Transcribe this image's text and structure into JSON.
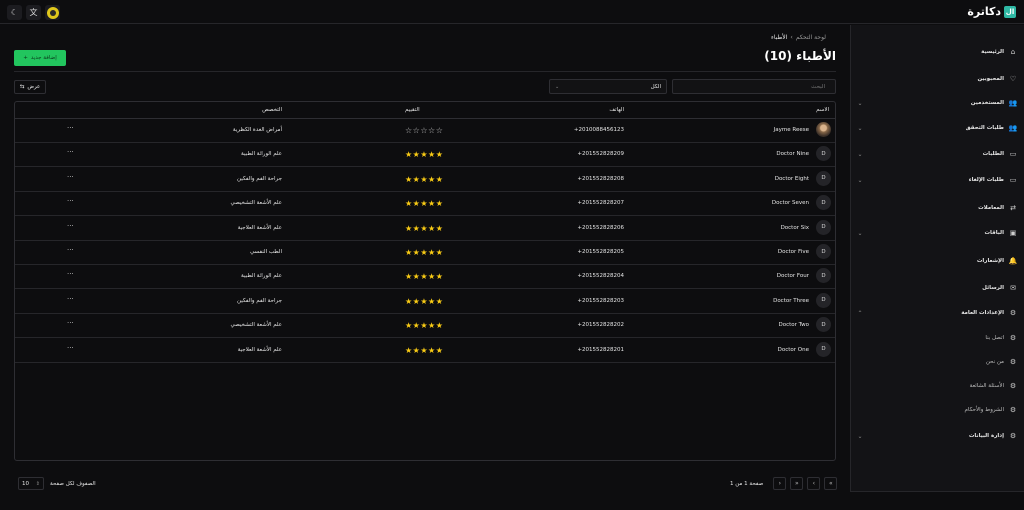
{
  "app": {
    "name": "دكاترة",
    "logo_mark": "ال"
  },
  "topbar": {
    "theme_icon": "moon-icon",
    "translate_icon": "translate-icon"
  },
  "sidebar": {
    "items": [
      {
        "label": "الرئيسية",
        "icon": "⌂",
        "chevron": ""
      },
      {
        "label": "المحبوبين",
        "icon": "♡",
        "chevron": ""
      },
      {
        "label": "المستخدمين",
        "icon": "👥",
        "chevron": "⌄"
      },
      {
        "label": "طلبات التحقق",
        "icon": "👥",
        "chevron": "⌄"
      },
      {
        "label": "الطلبات",
        "icon": "▭",
        "chevron": "⌄"
      },
      {
        "label": "طلبات الإلغاء",
        "icon": "▭",
        "chevron": "⌄"
      },
      {
        "label": "المعاملات",
        "icon": "⇄",
        "chevron": ""
      },
      {
        "label": "الباقات",
        "icon": "▣",
        "chevron": "⌄"
      },
      {
        "label": "الإشعارات",
        "icon": "🔔",
        "chevron": ""
      },
      {
        "label": "الرسائل",
        "icon": "✉",
        "chevron": ""
      },
      {
        "label": "الإعدادات العامة",
        "icon": "⚙",
        "chevron": "⌃"
      }
    ],
    "sub_items": [
      {
        "label": "اتصل بنا",
        "icon": "⚙"
      },
      {
        "label": "من نحن",
        "icon": "⚙"
      },
      {
        "label": "الأسئلة الشائعة",
        "icon": "⚙"
      },
      {
        "label": "الشروط والأحكام",
        "icon": "⚙"
      }
    ],
    "last_item": {
      "label": "إدارة البيانات",
      "icon": "⚙",
      "chevron": "⌄"
    }
  },
  "breadcrumb": {
    "root": "لوحة التحكم",
    "sep": "›",
    "current": "الأطباء"
  },
  "page": {
    "title": "الأطباء (10)"
  },
  "toolbar": {
    "add_label": "إضافة جديد",
    "add_icon": "+",
    "search_placeholder": "البحث",
    "filter_value": "الكل",
    "filter_arrow": "⌄",
    "view_label": "عرض",
    "view_icon": "⇆"
  },
  "table": {
    "headers": {
      "name": "الاسم",
      "phone": "الهاتف",
      "rating": "التقييم",
      "specialty": "التخصص"
    },
    "rows": [
      {
        "avatar": "",
        "name": "Jayme Reese",
        "phone": "+2010088456123",
        "rating": 0,
        "specialty": "أمراض الغدة الكظرية"
      },
      {
        "avatar": "D",
        "name": "Doctor Nine",
        "phone": "+201552828209",
        "rating": 5,
        "specialty": "علم الوراثة الطبية"
      },
      {
        "avatar": "D",
        "name": "Doctor Eight",
        "phone": "+201552828208",
        "rating": 5,
        "specialty": "جراحة الفم والفكين"
      },
      {
        "avatar": "D",
        "name": "Doctor Seven",
        "phone": "+201552828207",
        "rating": 5,
        "specialty": "علم الأشعة التشخيصي"
      },
      {
        "avatar": "D",
        "name": "Doctor Six",
        "phone": "+201552828206",
        "rating": 5,
        "specialty": "علم الأشعة العلاجية"
      },
      {
        "avatar": "D",
        "name": "Doctor Five",
        "phone": "+201552828205",
        "rating": 5,
        "specialty": "الطب النفسي"
      },
      {
        "avatar": "D",
        "name": "Doctor Four",
        "phone": "+201552828204",
        "rating": 5,
        "specialty": "علم الوراثة الطبية"
      },
      {
        "avatar": "D",
        "name": "Doctor Three",
        "phone": "+201552828203",
        "rating": 5,
        "specialty": "جراحة الفم والفكين"
      },
      {
        "avatar": "D",
        "name": "Doctor Two",
        "phone": "+201552828202",
        "rating": 5,
        "specialty": "علم الأشعة التشخيصي"
      },
      {
        "avatar": "D",
        "name": "Doctor One",
        "phone": "+201552828201",
        "rating": 5,
        "specialty": "علم الأشعة العلاجية"
      }
    ],
    "more_label": "···"
  },
  "pagination": {
    "page_text": "صفحة 1 من 1",
    "rows_label": "الصفوف لكل صفحة",
    "rows_value": "10",
    "first": "«",
    "prev": "‹",
    "next": "›",
    "last": "»"
  },
  "colors": {
    "accent": "#22c55e",
    "star": "#facc15",
    "logo": "#2fb9a5"
  }
}
